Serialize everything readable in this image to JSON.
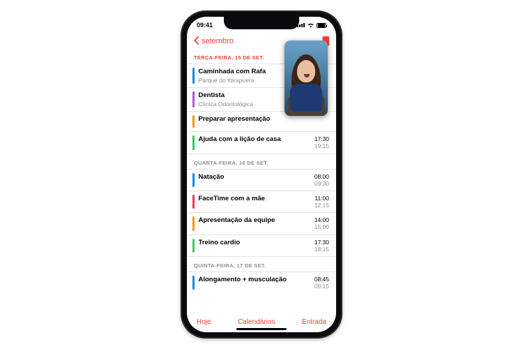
{
  "accent": "#ff3b30",
  "status": {
    "time": "09:41"
  },
  "nav": {
    "back_label": "setembro"
  },
  "toolbar": {
    "today": "Hoje",
    "calendars": "Calendários",
    "inbox": "Entrada"
  },
  "pip": {
    "name": "facetime-pip"
  },
  "days": [
    {
      "label": "TERÇA-FEIRA, 15 DE SET.",
      "accent": true,
      "events": [
        {
          "color": "#0a84ff",
          "title": "Caminhada com Rafa",
          "location": "Parque do Ibirapuera",
          "start": "",
          "end": ""
        },
        {
          "color": "#af52de",
          "title": "Dentista",
          "location": "Clínica Odontológica",
          "start": "",
          "end": ""
        },
        {
          "color": "#ff9500",
          "title": "Preparar apresentação",
          "location": "",
          "start": "",
          "end": ""
        },
        {
          "color": "#30d158",
          "title": "Ajuda com a lição de casa",
          "location": "",
          "start": "17:30",
          "end": "19:15"
        }
      ]
    },
    {
      "label": "QUARTA-FEIRA, 16 DE SET.",
      "accent": false,
      "events": [
        {
          "color": "#0a84ff",
          "title": "Natação",
          "location": "",
          "start": "08:00",
          "end": "09:00"
        },
        {
          "color": "#ff2d55",
          "title": "FaceTime com a mãe",
          "location": "",
          "start": "11:00",
          "end": "12:15"
        },
        {
          "color": "#ff9500",
          "title": "Apresentação da equipe",
          "location": "",
          "start": "14:00",
          "end": "15:00"
        },
        {
          "color": "#30d158",
          "title": "Treino cardio",
          "location": "",
          "start": "17:30",
          "end": "18:15"
        }
      ]
    },
    {
      "label": "QUINTA-FEIRA, 17 DE SET.",
      "accent": false,
      "events": [
        {
          "color": "#0a84ff",
          "title": "Alongamento + musculação",
          "location": "",
          "start": "08:45",
          "end": "09:15"
        }
      ]
    }
  ]
}
